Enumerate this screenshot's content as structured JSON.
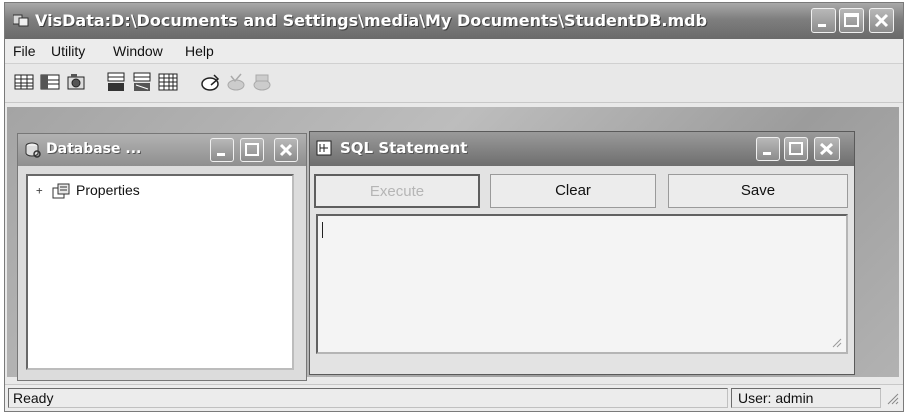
{
  "window": {
    "title": "VisData:D:\\Documents and Settings\\media\\My Documents\\StudentDB.mdb",
    "controls": [
      "minimize-icon",
      "maximize-icon",
      "close-icon"
    ]
  },
  "menu": {
    "items": [
      {
        "label": "File"
      },
      {
        "label": "Utility"
      },
      {
        "label": "Window"
      },
      {
        "label": "Help"
      }
    ]
  },
  "toolbar": {
    "icons": [
      "table-icon",
      "dynaset-icon",
      "snapshot-icon",
      "datacontrol-icon",
      "no-datacontrol-icon",
      "grid-icon",
      "begin-transaction-icon",
      "commit-icon",
      "rollback-icon"
    ]
  },
  "database_window": {
    "title": "Database ...",
    "tree": [
      {
        "label": "Properties",
        "expander": "+",
        "icon": "properties-icon"
      }
    ]
  },
  "sql_window": {
    "title": "SQL Statement",
    "buttons": {
      "execute": "Execute",
      "clear": "Clear",
      "save": "Save"
    },
    "query_text": ""
  },
  "status": {
    "left": "Ready",
    "right": "User: admin"
  },
  "colors": {
    "titlebar": "#7e7e7e",
    "face": "#e9e9e9",
    "mdi_background": "#a9a9a9"
  }
}
